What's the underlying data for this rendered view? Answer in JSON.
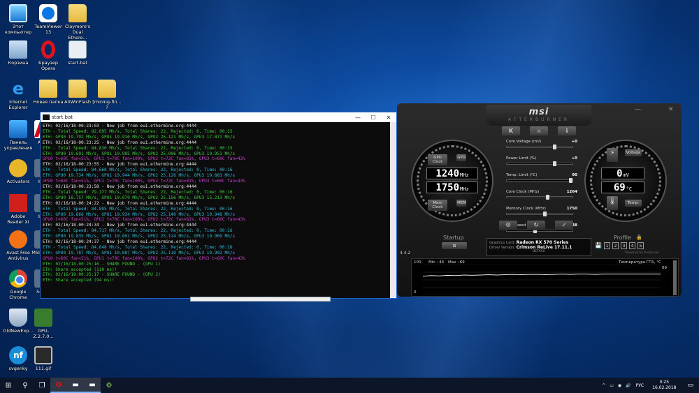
{
  "desktop_icons": [
    {
      "label": "Этот компьютер",
      "kind": "pc"
    },
    {
      "label": "TeamViewer 13",
      "kind": "tv"
    },
    {
      "label": "Claymore's Dual Ethere...",
      "kind": "folder"
    },
    {
      "label": "Корзина",
      "kind": "bin"
    },
    {
      "label": "Браузер Opera",
      "kind": "opera"
    },
    {
      "label": "start.bat",
      "kind": "bat"
    },
    {
      "label": "Internet Explorer",
      "kind": "ie"
    },
    {
      "label": "Новая папка",
      "kind": "folder"
    },
    {
      "label": "AtiWinFlash",
      "kind": "folder"
    },
    {
      "label": "[mining-fin... ?",
      "kind": "folder"
    },
    {
      "label": "Панель управления",
      "kind": "panel"
    },
    {
      "label": "ATIW",
      "kind": "atiwin"
    },
    {
      "label": "Activators",
      "kind": "activ"
    },
    {
      "label": "IMG_",
      "kind": "img"
    },
    {
      "label": "Adobe Reader XI",
      "kind": "pdf"
    },
    {
      "label": "IMG_",
      "kind": "img"
    },
    {
      "label": "Avast Free Antivirus",
      "kind": "avast"
    },
    {
      "label": "MSI Afterb",
      "kind": "img"
    },
    {
      "label": "Google Chrome",
      "kind": "chrome"
    },
    {
      "label": "Sense",
      "kind": "img"
    },
    {
      "label": "OldNewExp...",
      "kind": "shield"
    },
    {
      "label": "GPU-Z.2.7.0...",
      "kind": "gpuz"
    },
    {
      "label": "svgenky",
      "kind": "nf"
    },
    {
      "label": "111.gif",
      "kind": "gif"
    }
  ],
  "console": {
    "title": "start.bat",
    "controls": {
      "minimize": "—",
      "maximize": "☐",
      "close": "✕"
    },
    "lines": [
      {
        "t": "ETH: 02/16/18-00:23:03 - New job from eu1.ethermine.org:4444",
        "c": "white"
      },
      {
        "t": "ETH - Total Speed: 82.695 Mh/s, Total Shares: 22, Rejected: 0, Time: 00:15",
        "c": "green"
      },
      {
        "t": "ETH: GPU0 19.792 Mh/s, GPU1 19.910 Mh/s, GPU2 25.121 Mh/s, GPU3 17.871 Mh/s",
        "c": "green"
      },
      {
        "t": "ETH: 02/16/18-00:23:25 - New job from eu1.ethermine.org:4444",
        "c": "white"
      },
      {
        "t": "ETH - Total Speed: 84.830 Mh/s, Total Shares: 22, Rejected: 0, Time: 00:15",
        "c": "green"
      },
      {
        "t": "ETH: GPU0 19.691 Mh/s, GPU1 19.985 Mh/s, GPU2 25.006 Mh/s, GPU3 19.951 Mh/s",
        "c": "green"
      },
      {
        "t": "GPU0 t=60C fan=51%, GPU1 t=70C fan=100%, GPU2 t=72C fan=81%, GPU3 t=60C fan=43%",
        "c": "magenta"
      },
      {
        "t": "ETH: 02/16/18-00:23:55 - New job from eu1.ethermine.org:4444",
        "c": "white"
      },
      {
        "t": "ETH - Total Speed: 84.668 Mh/s, Total Shares: 22, Rejected: 0, Time: 00:16",
        "c": "cyan"
      },
      {
        "t": "ETH: GPU0 19.734 Mh/s, GPU1 19.944 Mh/s, GPU2 25.126 Mh/s, GPU3 19.883 Mh/s",
        "c": "cyan"
      },
      {
        "t": "GPU0 t=60C fan=51%, GPU1 t=70C fan=100%, GPU2 t=72C fan=81%, GPU3 t=60C fan=43%",
        "c": "magenta"
      },
      {
        "t": "ETH: 02/16/18-00:23:58 - New job from eu1.ethermine.org:4444",
        "c": "white"
      },
      {
        "t": "ETH - Total Speed: 79.177 Mh/s, Total Shares: 22, Rejected: 0, Time: 00:16",
        "c": "green"
      },
      {
        "t": "ETH: GPU0 18.757 Mh/s, GPU1 19.079 Mh/s, GPU2 25.156 Mh/s, GPU3 15.213 Mh/s",
        "c": "green"
      },
      {
        "t": "ETH: 02/16/18-00:24:22 - New job from eu1.ethermine.org:4444",
        "c": "white"
      },
      {
        "t": "ETH - Total Speed: 84.895 Mh/s, Total Shares: 22, Rejected: 0, Time: 00:16",
        "c": "cyan"
      },
      {
        "t": "ETH: GPU0 19.866 Mh/s, GPU1 19.934 Mh/s, GPU2 25.140 Mh/s, GPU3 19.948 Mh/s",
        "c": "cyan"
      },
      {
        "t": "GPU0 t=60C fan=51%, GPU1 t=70C fan=100%, GPU2 t=72C fan=81%, GPU3 t=60C fan=43%",
        "c": "magenta"
      },
      {
        "t": "ETH: 02/16/18-00:24:34 - New job from eu1.ethermine.org:4444",
        "c": "white"
      },
      {
        "t": "ETH - Total Speed: 84.717 Mh/s, Total Shares: 22, Rejected: 0, Time: 00:16",
        "c": "cyan"
      },
      {
        "t": "ETH: GPU0 19.835 Mh/s, GPU1 19.801 Mh/s, GPU2 25.124 Mh/s, GPU3 19.969 Mh/s",
        "c": "cyan"
      },
      {
        "t": "ETH: 02/16/18-00:24:37 - New job from eu1.ethermine.org:4444",
        "c": "white"
      },
      {
        "t": "ETH - Total Speed: 84.648 Mh/s, Total Shares: 22, Rejected: 0, Time: 00:16",
        "c": "cyan"
      },
      {
        "t": "ETH: GPU0 19.787 Mh/s, GPU1 19.887 Mh/s, GPU2 25.110 Mh/s, GPU3 19.902 Mh/s",
        "c": "cyan"
      },
      {
        "t": "GPU0 t=60C fan=51%, GPU1 t=70C fan=100%, GPU2 t=72C fan=81%, GPU3 t=60C fan=43%",
        "c": "magenta"
      },
      {
        "t": "ETH: 02/16/18-00:25:16 - SHARE FOUND - (GPU 1)",
        "c": "green"
      },
      {
        "t": "ETH: Share accepted (110 ms)!",
        "c": "green"
      },
      {
        "t": "ETH: 02/16/18-00:25:17 - SHARE FOUND - (GPU 2)",
        "c": "green"
      },
      {
        "t": "ETH: Share accepted (94 ms)!",
        "c": "green"
      }
    ]
  },
  "afterburner": {
    "brand": "msi",
    "subtitle": "AFTERBURNER",
    "window_controls": {
      "minimize": "—",
      "close": "✕"
    },
    "top_buttons": [
      "K",
      "⚔",
      "i"
    ],
    "left_gauge": {
      "label_gpu": "GPU Clock",
      "label_mem": "Mem Clock",
      "gpu_value": "1240",
      "gpu_unit": "MHz",
      "mem_value": "1750",
      "mem_unit": "MHz",
      "gpu_badge": "GPU",
      "mem_badge": "MEM"
    },
    "sliders": [
      {
        "label": "Core Voltage (mV)",
        "value": "+0"
      },
      {
        "label": "Power Limit (%)",
        "value": "+0"
      },
      {
        "label": "Temp. Limit (°C)",
        "value": "90"
      },
      {
        "label": "Core Clock (MHz)",
        "value": "1264"
      },
      {
        "label": "Memory Clock (MHz)",
        "value": "1750"
      },
      {
        "label": "Fan Speed (%)",
        "value": "48"
      }
    ],
    "right_gauge": {
      "label_voltage": "Voltage",
      "label_temp": "Temp.",
      "volt_value": "0",
      "volt_unit": "mV",
      "temp_value": "69",
      "temp_unit": "°C"
    },
    "bottom_buttons": [
      "⚙",
      "↻",
      "✓"
    ],
    "startup_label": "Startup",
    "profile_label": "Profile",
    "profile_lock": "🔒",
    "profile_buttons": [
      "1",
      "2",
      "3",
      "4",
      "5"
    ],
    "save_icon": "💾",
    "version": "4.4.2",
    "graphics_card_label": "Graphics Card:",
    "graphics_card": "Radeon RX 570 Series",
    "driver_label": "Driver Version:",
    "driver": "Crimson ReLive 17.11.1",
    "detach": "DETACH",
    "powered_by": "Powered by Rivatuner",
    "monitor": {
      "top_value": "100",
      "bottom_value": "0",
      "min_label": "Min : 44",
      "max_label": "Max : 69",
      "series_name": "Температура ГП1, °С",
      "current": "69",
      "chart_data": {
        "type": "line",
        "series": [
          {
            "name": "Температура ГП1, °С",
            "values": [
              62,
              64,
              63,
              65,
              64,
              66,
              65,
              66,
              67,
              66,
              67,
              68,
              67,
              68,
              68,
              67,
              68,
              69,
              68,
              69,
              69,
              68,
              69,
              69,
              69,
              69,
              69,
              69,
              69,
              69
            ]
          }
        ],
        "ylim": [
          0,
          100
        ]
      }
    }
  },
  "taskbar": {
    "start": "⊞",
    "search": "⚲",
    "taskview": "❐",
    "apps": [
      "O",
      "▬",
      "▬",
      "⚙"
    ],
    "tray": {
      "lang": "РУС",
      "time": "0:25",
      "date": "16.02.2018",
      "icons": [
        "^",
        "▭",
        "◉",
        "🔊"
      ]
    }
  }
}
